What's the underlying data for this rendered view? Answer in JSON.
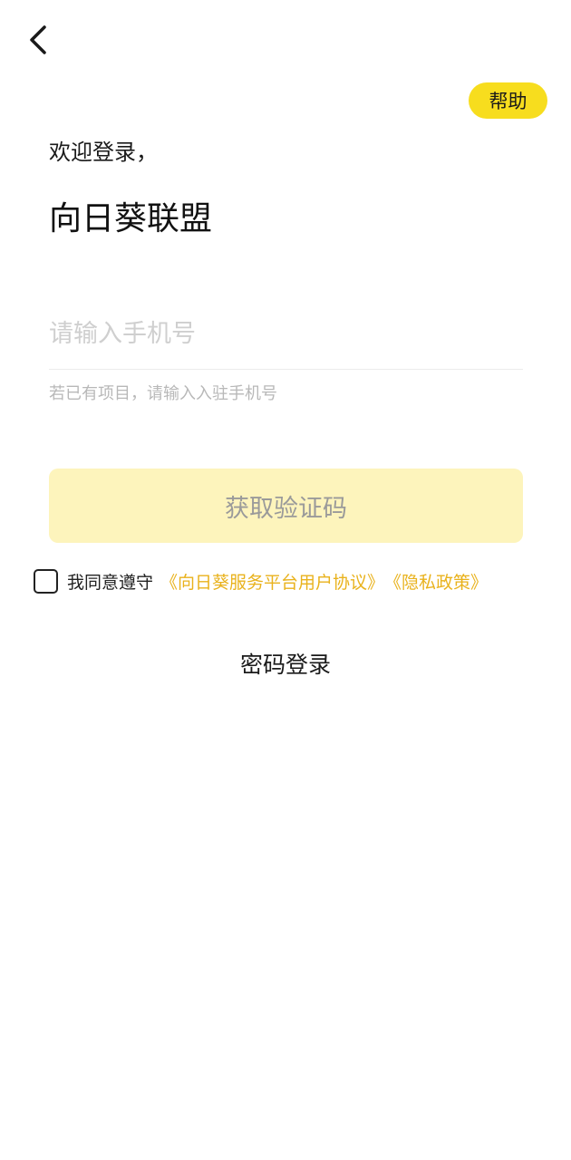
{
  "header": {
    "back_icon": "chevron-left-icon",
    "help_label": "帮助"
  },
  "greeting": {
    "welcome": "欢迎登录，",
    "app_name": "向日葵联盟"
  },
  "form": {
    "phone_placeholder": "请输入手机号",
    "phone_value": "",
    "hint": "若已有项目，请输入入驻手机号",
    "submit_label": "获取验证码"
  },
  "agreement": {
    "checked": false,
    "prefix": "我同意遵守",
    "links": [
      "《向日葵服务平台用户协议》",
      "《隐私政策》"
    ]
  },
  "alt_login": {
    "password_login_label": "密码登录"
  },
  "colors": {
    "accent": "#f7dd1e",
    "button_disabled_bg": "#fdf4bc",
    "link": "#e9b21c"
  }
}
